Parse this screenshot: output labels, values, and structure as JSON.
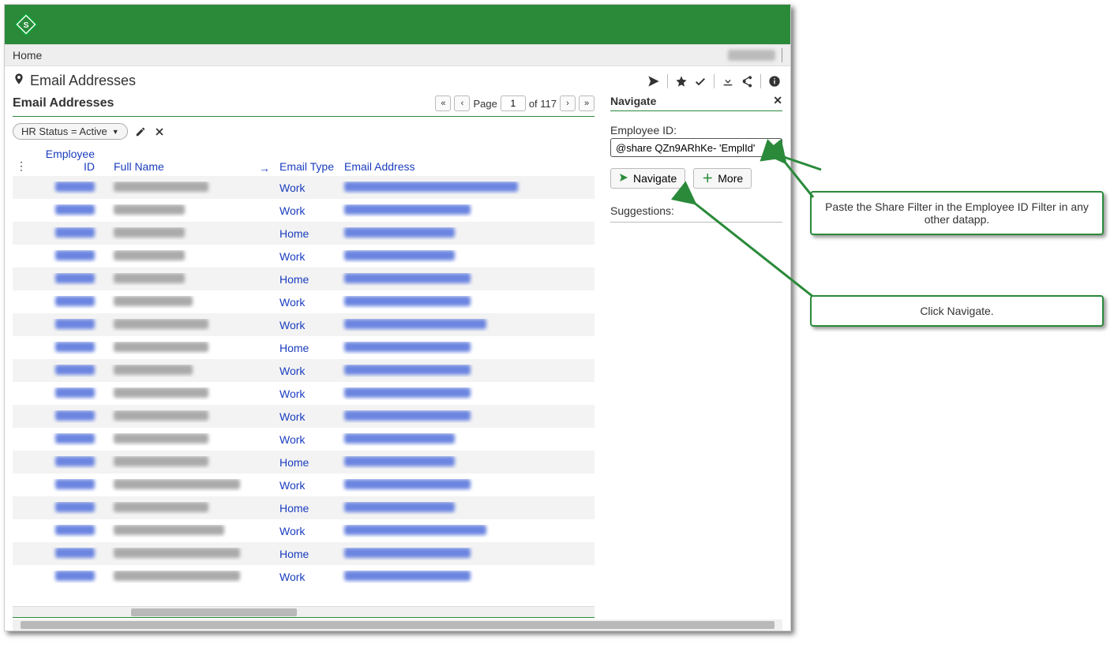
{
  "crumbs": {
    "home": "Home"
  },
  "page": {
    "title": "Email Addresses"
  },
  "list": {
    "title": "Email Addresses",
    "page_label": "Page",
    "page_value": "1",
    "page_total": "of 117"
  },
  "filter": {
    "chip": "HR Status = Active"
  },
  "columns": {
    "employee_id": "Employee ID",
    "full_name": "Full Name",
    "email_type": "Email Type",
    "email_address": "Email Address"
  },
  "rows": [
    {
      "type": "Work",
      "nameW": "w120",
      "emailW": "w220"
    },
    {
      "type": "Work",
      "nameW": "w90",
      "emailW": "w160"
    },
    {
      "type": "Home",
      "nameW": "w90",
      "emailW": "w140"
    },
    {
      "type": "Work",
      "nameW": "w90",
      "emailW": "w140"
    },
    {
      "type": "Home",
      "nameW": "w90",
      "emailW": "w160"
    },
    {
      "type": "Work",
      "nameW": "w100",
      "emailW": "w160"
    },
    {
      "type": "Work",
      "nameW": "w120",
      "emailW": "w180"
    },
    {
      "type": "Home",
      "nameW": "w120",
      "emailW": "w160"
    },
    {
      "type": "Work",
      "nameW": "w100",
      "emailW": "w160"
    },
    {
      "type": "Work",
      "nameW": "w120",
      "emailW": "w160"
    },
    {
      "type": "Work",
      "nameW": "w120",
      "emailW": "w160"
    },
    {
      "type": "Work",
      "nameW": "w120",
      "emailW": "w140"
    },
    {
      "type": "Home",
      "nameW": "w120",
      "emailW": "w140"
    },
    {
      "type": "Work",
      "nameW": "w160",
      "emailW": "w160"
    },
    {
      "type": "Home",
      "nameW": "w120",
      "emailW": "w140"
    },
    {
      "type": "Work",
      "nameW": "w140",
      "emailW": "w180"
    },
    {
      "type": "Home",
      "nameW": "w160",
      "emailW": "w160"
    },
    {
      "type": "Work",
      "nameW": "w160",
      "emailW": "w160"
    }
  ],
  "navigate": {
    "title": "Navigate",
    "field_label": "Employee ID:",
    "field_value": "@share QZn9ARhKe- 'EmplId'",
    "btn_navigate": "Navigate",
    "btn_more": "More",
    "suggestions": "Suggestions:"
  },
  "callouts": {
    "c1": "Paste the Share Filter in the Employee ID Filter in any other datapp.",
    "c2": "Click Navigate."
  }
}
